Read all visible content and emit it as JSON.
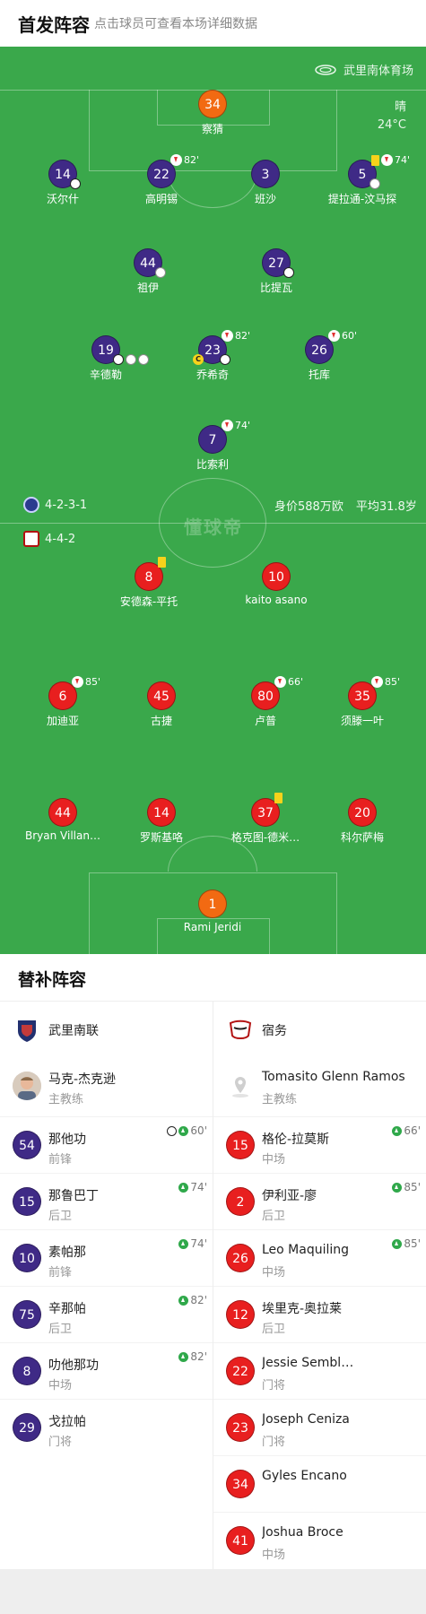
{
  "header": {
    "title": "首发阵容",
    "subtitle": "点击球员可查看本场详细数据"
  },
  "match": {
    "venue": "武里南体育场",
    "weather": "晴",
    "temperature": "24°C",
    "watermark": "懂球帝"
  },
  "home_team": {
    "formation": "4-2-3-1",
    "value_label": "身价588万欧",
    "avg_age_label": "平均31.8岁",
    "color": "#3f2a86"
  },
  "away_team": {
    "formation": "4-4-2",
    "color": "#e81f1f"
  },
  "home_players": [
    {
      "num": "34",
      "name": "察猜",
      "gk": true
    },
    {
      "num": "14",
      "name": "沃尔什"
    },
    {
      "num": "22",
      "name": "高明锡",
      "sub_min": "82'"
    },
    {
      "num": "3",
      "name": "班沙"
    },
    {
      "num": "5",
      "name": "提拉通-汶马探",
      "sub_min": "74'"
    },
    {
      "num": "44",
      "name": "祖伊"
    },
    {
      "num": "27",
      "name": "比提瓦"
    },
    {
      "num": "19",
      "name": "辛德勒"
    },
    {
      "num": "23",
      "name": "乔希奇",
      "sub_min": "82'"
    },
    {
      "num": "26",
      "name": "托库",
      "sub_min": "60'"
    },
    {
      "num": "7",
      "name": "比索利",
      "sub_min": "74'"
    }
  ],
  "away_players": [
    {
      "num": "8",
      "name": "安德森-平托"
    },
    {
      "num": "10",
      "name": "kaito asano"
    },
    {
      "num": "6",
      "name": "加迪亚",
      "sub_min": "85'"
    },
    {
      "num": "45",
      "name": "古捷"
    },
    {
      "num": "80",
      "name": "卢普",
      "sub_min": "66'"
    },
    {
      "num": "35",
      "name": "须滕一叶",
      "sub_min": "85'"
    },
    {
      "num": "44",
      "name": "Bryan Villan…"
    },
    {
      "num": "14",
      "name": "罗斯基咯"
    },
    {
      "num": "37",
      "name": "格克图-德米…"
    },
    {
      "num": "20",
      "name": "科尔萨梅"
    },
    {
      "num": "1",
      "name": "Rami Jeridi",
      "gk": true
    }
  ],
  "subs": {
    "title": "替补阵容",
    "home": {
      "team_name": "武里南联",
      "coach_name": "马克-杰克逊",
      "coach_role": "主教练",
      "players": [
        {
          "num": "54",
          "name": "那他功",
          "pos": "前锋",
          "in_min": "60'",
          "goal": true
        },
        {
          "num": "15",
          "name": "那鲁巴丁",
          "pos": "后卫",
          "in_min": "74'"
        },
        {
          "num": "10",
          "name": "素帕那",
          "pos": "前锋",
          "in_min": "74'"
        },
        {
          "num": "75",
          "name": "辛那帕",
          "pos": "后卫",
          "in_min": "82'"
        },
        {
          "num": "8",
          "name": "叻他那功",
          "pos": "中场",
          "in_min": "82'"
        },
        {
          "num": "29",
          "name": "戈拉帕",
          "pos": "门将"
        }
      ]
    },
    "away": {
      "team_name": "宿务",
      "coach_name": "Tomasito Glenn Ramos",
      "coach_role": "主教练",
      "players": [
        {
          "num": "15",
          "name": "格伦-拉莫斯",
          "pos": "中场",
          "in_min": "66'"
        },
        {
          "num": "2",
          "name": "伊利亚-廖",
          "pos": "后卫",
          "in_min": "85'"
        },
        {
          "num": "26",
          "name": "Leo Maquiling",
          "pos": "中场",
          "in_min": "85'"
        },
        {
          "num": "12",
          "name": "埃里克-奥拉莱",
          "pos": "后卫"
        },
        {
          "num": "22",
          "name": "Jessie Sembl…",
          "pos": "门将"
        },
        {
          "num": "23",
          "name": "Joseph Ceniza",
          "pos": "门将"
        },
        {
          "num": "34",
          "name": "Gyles Encano",
          "pos": ""
        },
        {
          "num": "41",
          "name": "Joshua Broce",
          "pos": "中场"
        }
      ]
    }
  }
}
